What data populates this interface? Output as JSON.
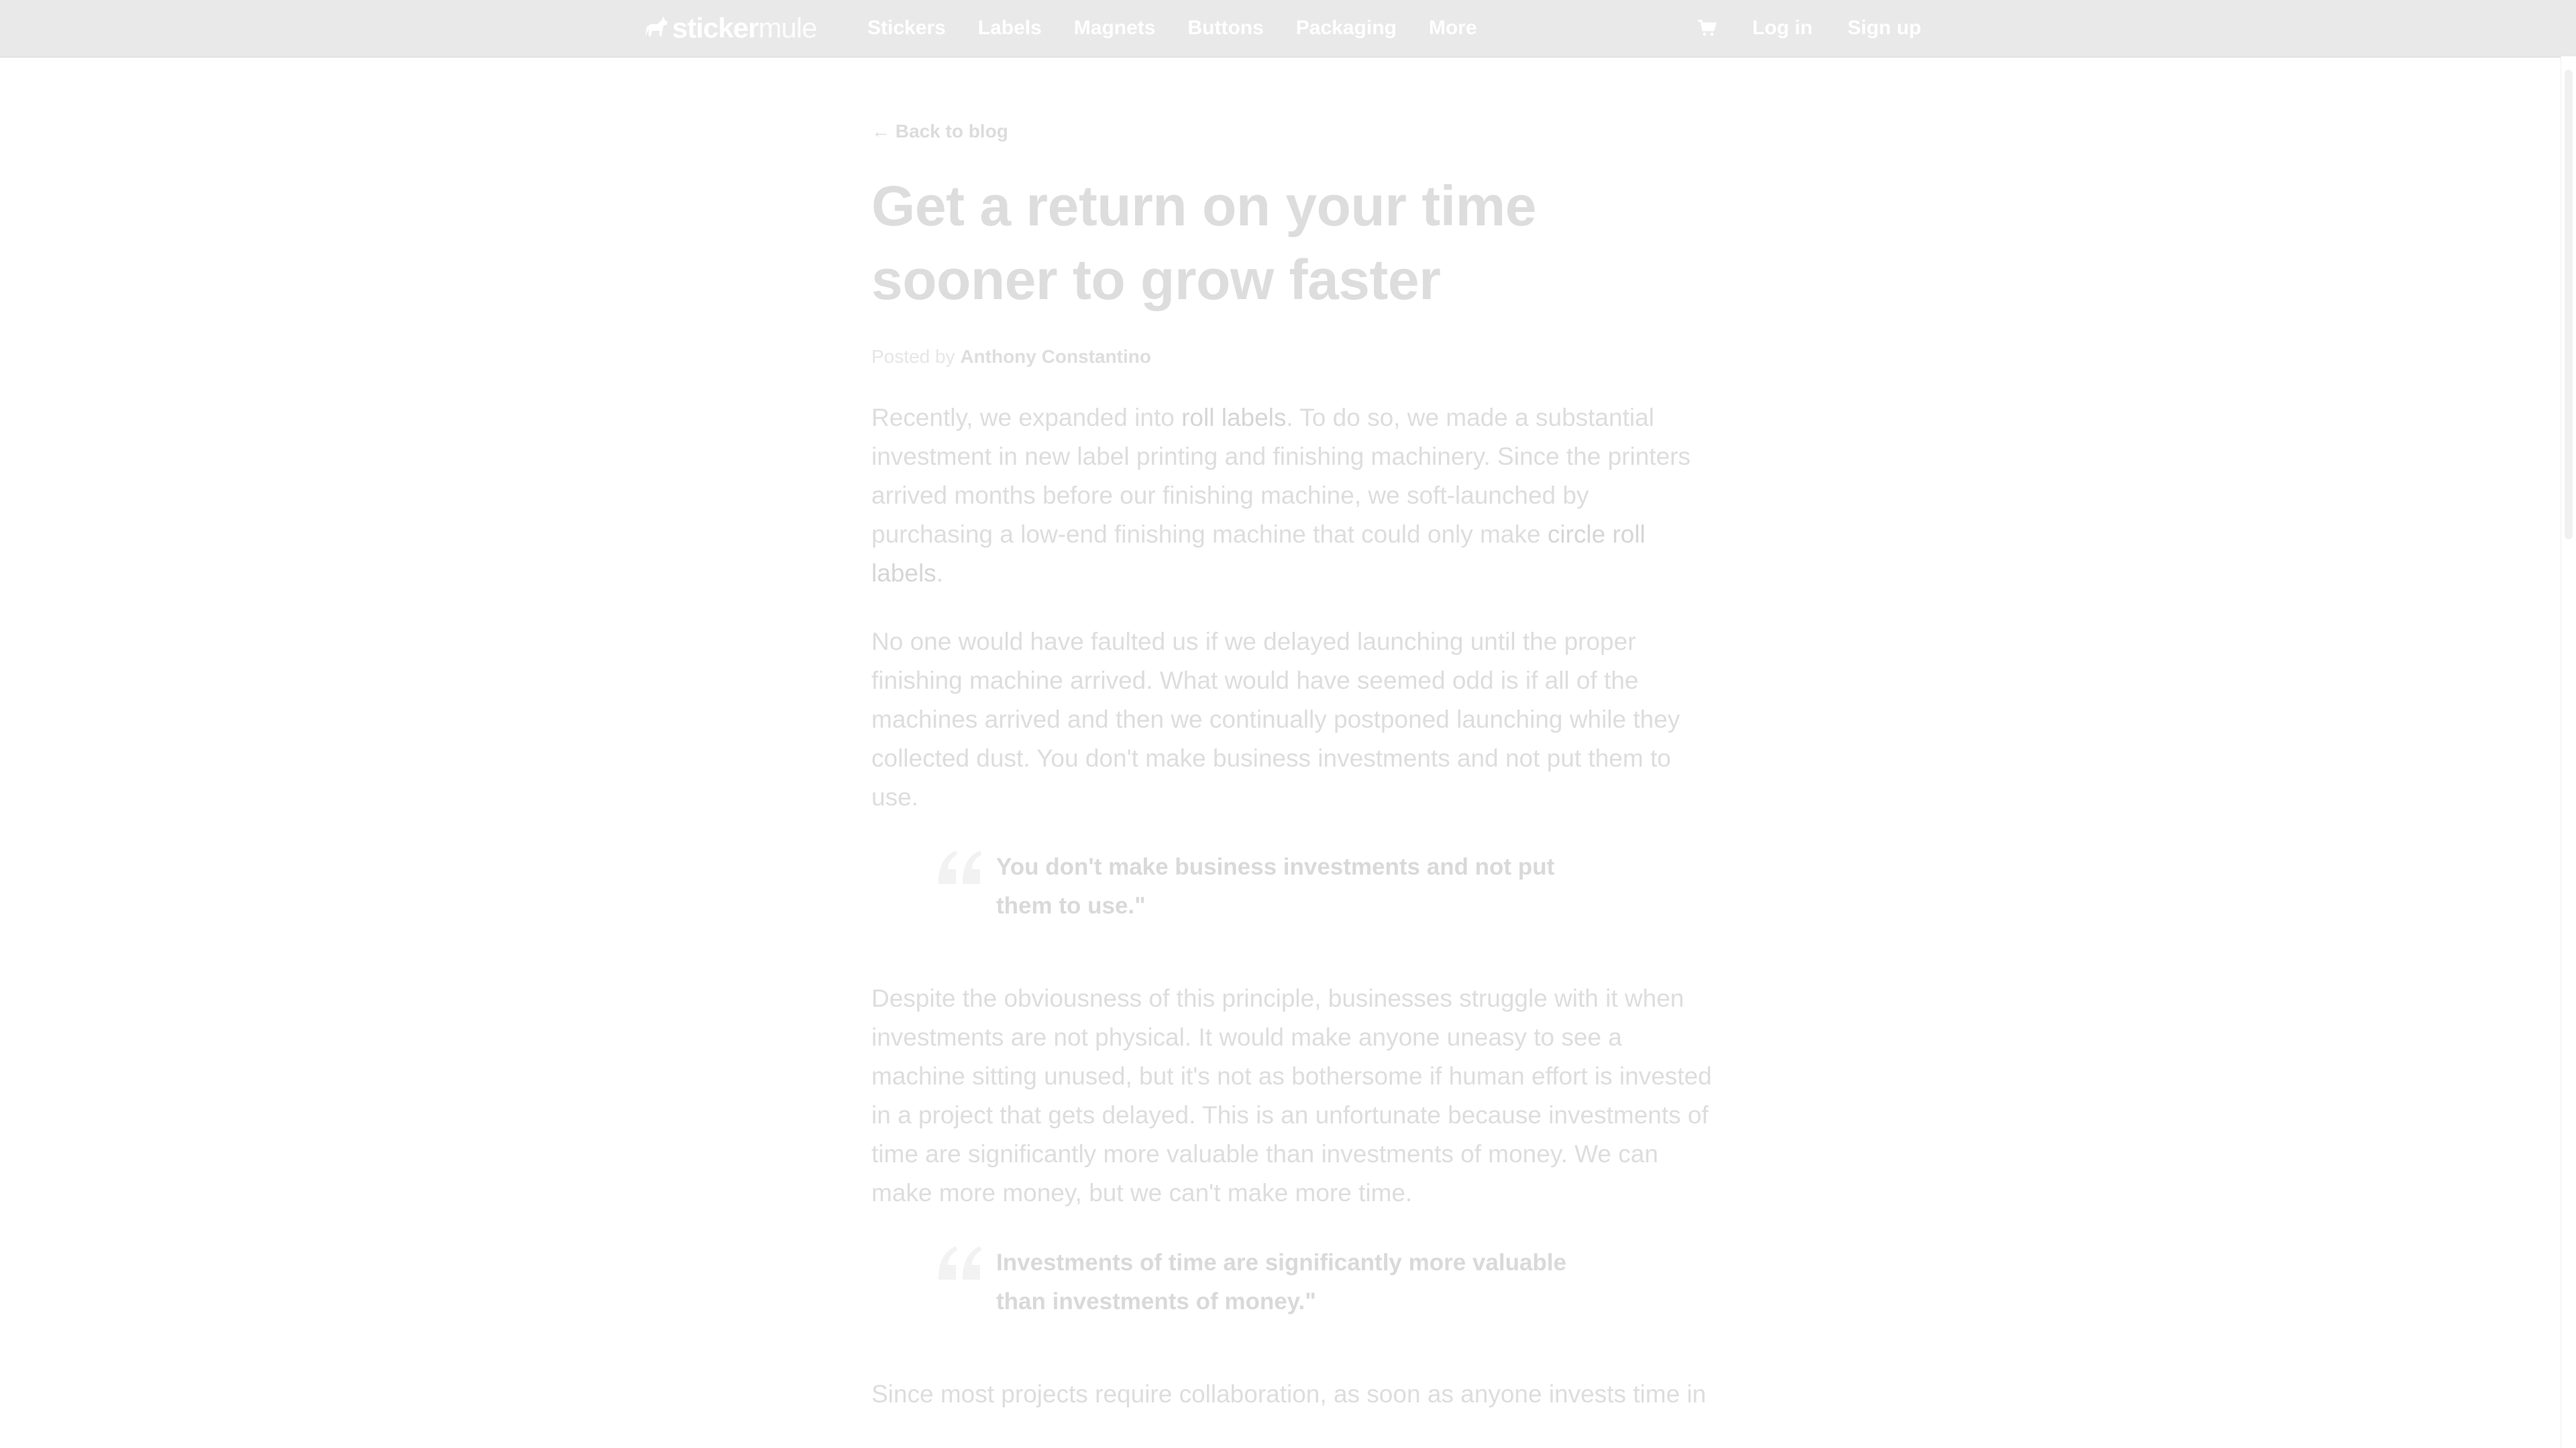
{
  "nav": {
    "logo": {
      "word_bold": "sticker",
      "word_light": "mule"
    },
    "links": [
      "Stickers",
      "Labels",
      "Magnets",
      "Buttons",
      "Packaging",
      "More"
    ],
    "cart_icon": "cart-icon",
    "login": "Log in",
    "signup": "Sign up"
  },
  "article": {
    "back_link": "← Back to blog",
    "title": "Get a return on your time sooner to grow faster",
    "byline_prefix": "Posted by",
    "author": "Anthony Constantino",
    "p1": {
      "a": "Recently, we expanded into ",
      "link1": "roll labels",
      "b": ". To do so, we made a substantial investment in new label printing and finishing machinery. Since the printers arrived months before our finishing machine, we soft-launched by purchasing a low-end finishing machine that could only make ",
      "link2": "circle roll labels",
      "c": "."
    },
    "p2": "No one would have faulted us if we delayed launching until the proper finishing machine arrived. What would have seemed odd is if all of the machines arrived and then we continually postponed launching while they collected dust. You don't make business investments and not put them to use.",
    "quote1": "You don't make business investments and not put them to use.\"",
    "p3": "Despite the obviousness of this principle, businesses struggle with it when investments are not physical. It would make anyone uneasy to see a machine sitting unused, but it's not as bothersome if human effort is invested in a project that gets delayed. This is an unfortunate because investments of time are significantly more valuable than investments of money. We can make more money, but we can't make more time.",
    "quote2": "Investments of time are significantly more valuable than investments of money.\"",
    "p4": "Since most projects require collaboration, as soon as anyone invests time in"
  },
  "colors": {
    "topbar": "#e9e9e9",
    "nav_text": "#ffffff",
    "faded_text": "#dddddd"
  }
}
